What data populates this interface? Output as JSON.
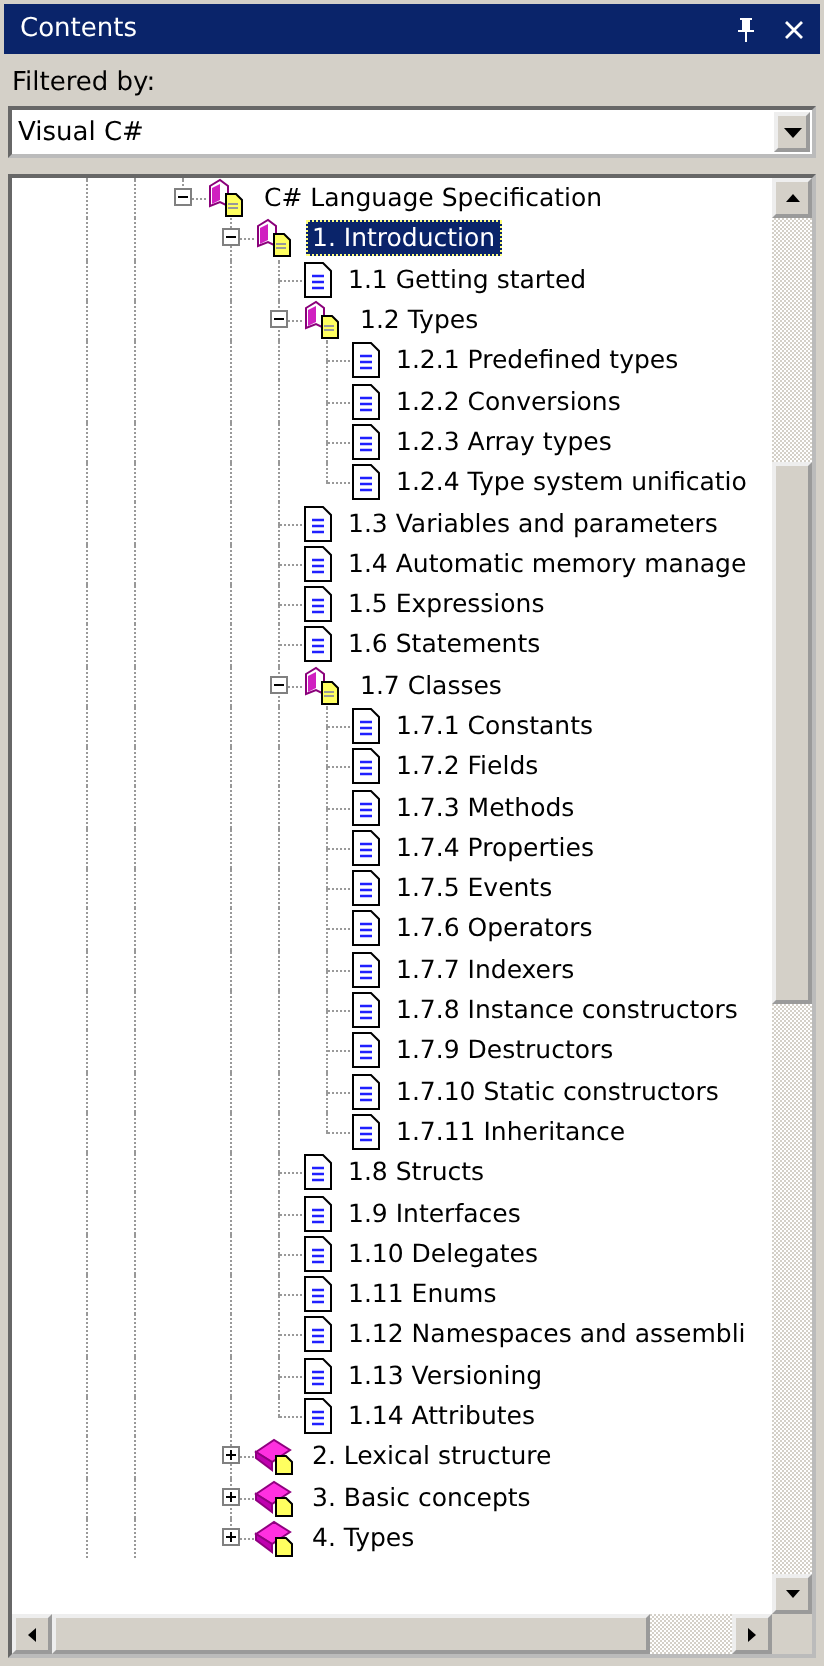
{
  "window": {
    "title": "Contents"
  },
  "filter": {
    "label": "Filtered by:",
    "value": "Visual C#"
  },
  "tree": [
    {
      "label": "C# Language Specification",
      "kind": "book",
      "expanded": true,
      "selected": false,
      "children": [
        {
          "label": "1. Introduction",
          "kind": "book",
          "expanded": true,
          "selected": true,
          "children": [
            {
              "label": "1.1 Getting started",
              "kind": "page",
              "selected": false
            },
            {
              "label": "1.2 Types",
              "kind": "book",
              "expanded": true,
              "selected": false,
              "children": [
                {
                  "label": "1.2.1 Predefined types",
                  "kind": "page",
                  "selected": false
                },
                {
                  "label": "1.2.2 Conversions",
                  "kind": "page",
                  "selected": false
                },
                {
                  "label": "1.2.3 Array types",
                  "kind": "page",
                  "selected": false
                },
                {
                  "label": "1.2.4 Type system unificatio",
                  "kind": "page",
                  "selected": false
                }
              ]
            },
            {
              "label": "1.3 Variables and parameters",
              "kind": "page",
              "selected": false
            },
            {
              "label": "1.4 Automatic memory manage",
              "kind": "page",
              "selected": false
            },
            {
              "label": "1.5 Expressions",
              "kind": "page",
              "selected": false
            },
            {
              "label": "1.6 Statements",
              "kind": "page",
              "selected": false
            },
            {
              "label": "1.7 Classes",
              "kind": "book",
              "expanded": true,
              "selected": false,
              "children": [
                {
                  "label": "1.7.1 Constants",
                  "kind": "page",
                  "selected": false
                },
                {
                  "label": "1.7.2 Fields",
                  "kind": "page",
                  "selected": false
                },
                {
                  "label": "1.7.3 Methods",
                  "kind": "page",
                  "selected": false
                },
                {
                  "label": "1.7.4 Properties",
                  "kind": "page",
                  "selected": false
                },
                {
                  "label": "1.7.5 Events",
                  "kind": "page",
                  "selected": false
                },
                {
                  "label": "1.7.6 Operators",
                  "kind": "page",
                  "selected": false
                },
                {
                  "label": "1.7.7 Indexers",
                  "kind": "page",
                  "selected": false
                },
                {
                  "label": "1.7.8 Instance constructors",
                  "kind": "page",
                  "selected": false
                },
                {
                  "label": "1.7.9 Destructors",
                  "kind": "page",
                  "selected": false
                },
                {
                  "label": "1.7.10 Static constructors",
                  "kind": "page",
                  "selected": false
                },
                {
                  "label": "1.7.11 Inheritance",
                  "kind": "page",
                  "selected": false
                }
              ]
            },
            {
              "label": "1.8 Structs",
              "kind": "page",
              "selected": false
            },
            {
              "label": "1.9 Interfaces",
              "kind": "page",
              "selected": false
            },
            {
              "label": "1.10 Delegates",
              "kind": "page",
              "selected": false
            },
            {
              "label": "1.11 Enums",
              "kind": "page",
              "selected": false
            },
            {
              "label": "1.12 Namespaces and assembli",
              "kind": "page",
              "selected": false
            },
            {
              "label": "1.13 Versioning",
              "kind": "page",
              "selected": false
            },
            {
              "label": "1.14 Attributes",
              "kind": "page",
              "selected": false
            }
          ]
        },
        {
          "label": "2. Lexical structure",
          "kind": "book",
          "expanded": false,
          "selected": false
        },
        {
          "label": "3. Basic concepts",
          "kind": "book",
          "expanded": false,
          "selected": false
        },
        {
          "label": "4. Types",
          "kind": "book",
          "expanded": false,
          "selected": false
        }
      ]
    }
  ]
}
